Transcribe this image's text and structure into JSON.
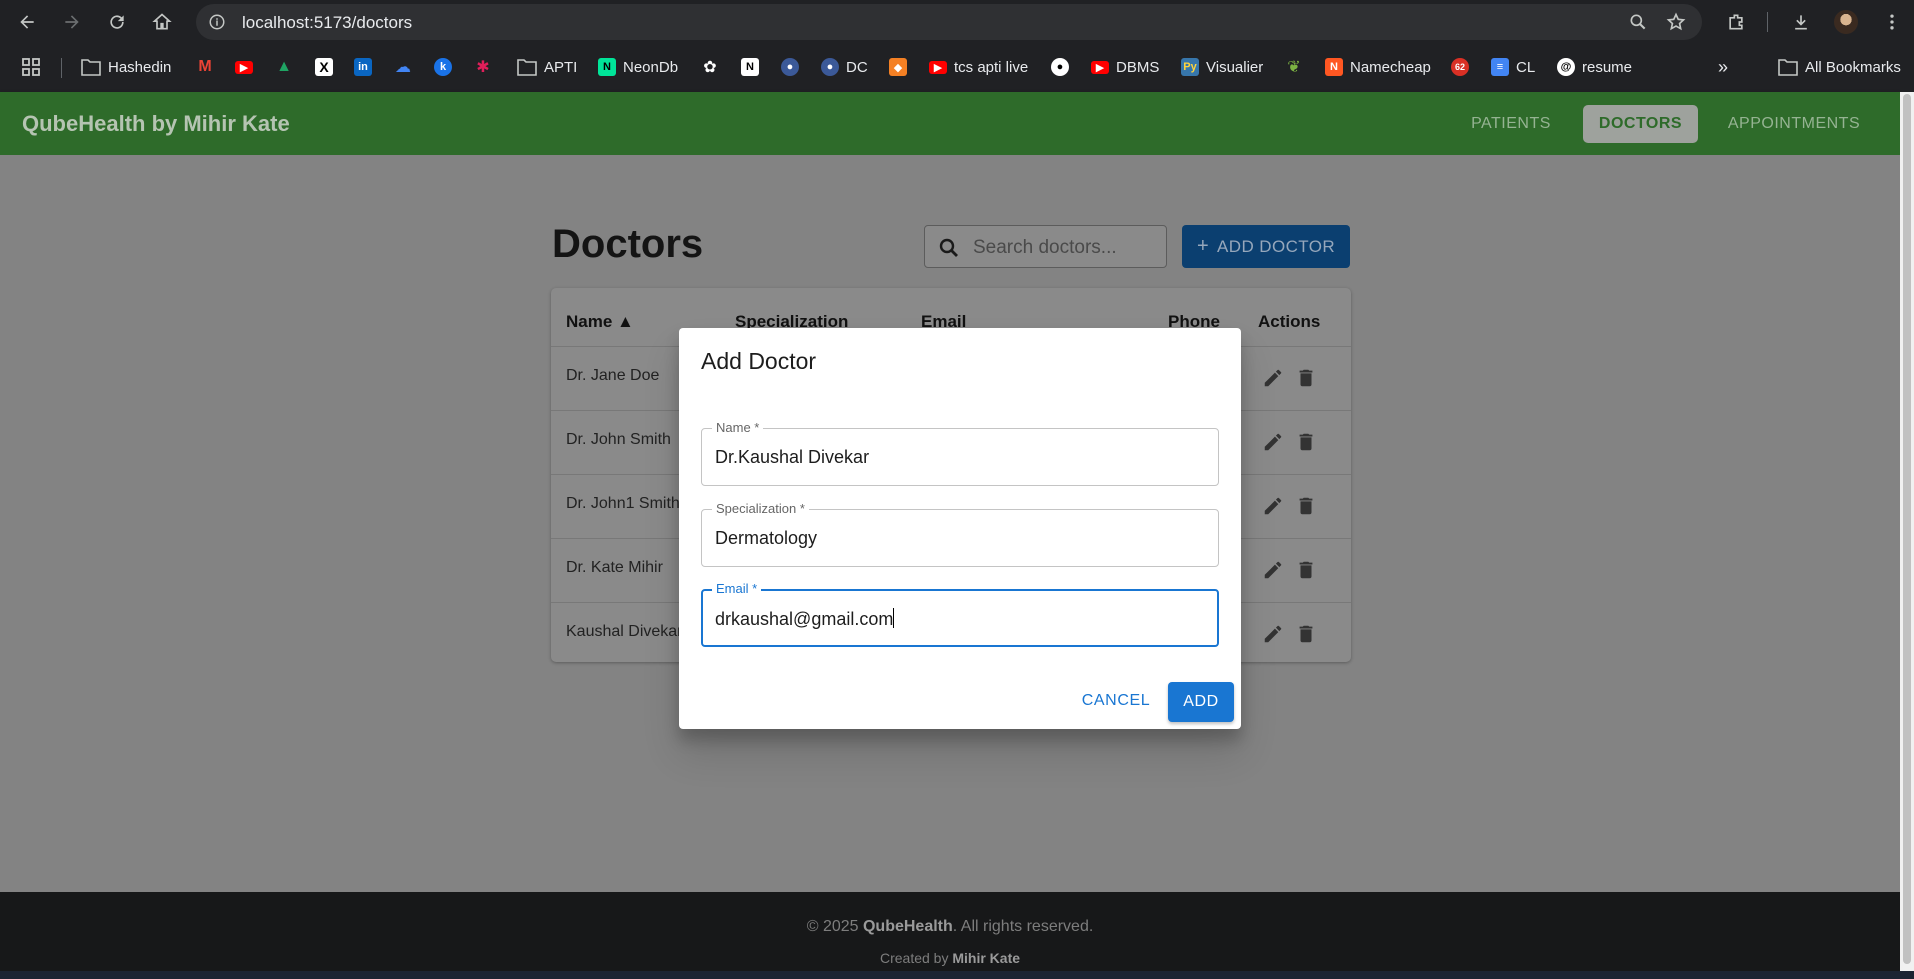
{
  "browser": {
    "url": "localhost:5173/doctors",
    "bookmarks": [
      {
        "label": "Hashedin",
        "icon": "folder-icon"
      },
      {
        "label": "",
        "icon": "gmail-icon",
        "color": "#ea4335"
      },
      {
        "label": "",
        "icon": "youtube-icon",
        "color": "#ff0000"
      },
      {
        "label": "",
        "icon": "drive-icon",
        "color": "#1fa463"
      },
      {
        "label": "",
        "icon": "x-icon",
        "color": "#000000"
      },
      {
        "label": "",
        "icon": "linkedin-icon",
        "color": "#0a66c2"
      },
      {
        "label": "",
        "icon": "cloud-icon",
        "color": "#4285f4"
      },
      {
        "label": "",
        "icon": "kotak-icon",
        "color": "#1a73e8"
      },
      {
        "label": "",
        "icon": "slack-icon",
        "color": "#e01e5a"
      },
      {
        "label": "APTI",
        "icon": "folder-icon"
      },
      {
        "label": "NeonDb",
        "icon": "neon-icon",
        "color": "#00e599"
      },
      {
        "label": "",
        "icon": "openai-icon",
        "color": "#ffffff"
      },
      {
        "label": "",
        "icon": "notion-icon",
        "color": "#ffffff"
      },
      {
        "label": "",
        "icon": "avatar-bookmark-icon",
        "color": "#3b5998"
      },
      {
        "label": "DC",
        "icon": "avatar-bookmark-icon",
        "color": "#3b5998"
      },
      {
        "label": "",
        "icon": "box-icon",
        "color": "#f48024"
      },
      {
        "label": "tcs apti live",
        "icon": "youtube-icon",
        "color": "#ff0000"
      },
      {
        "label": "",
        "icon": "github-icon",
        "color": "#ffffff"
      },
      {
        "label": "DBMS",
        "icon": "youtube-icon",
        "color": "#ff0000"
      },
      {
        "label": "Visualier",
        "icon": "python-icon",
        "color": "#3776ab"
      },
      {
        "label": "",
        "icon": "leaf-icon",
        "color": "#7cb342"
      },
      {
        "label": "Namecheap",
        "icon": "namecheap-icon",
        "color": "#ff5722"
      },
      {
        "label": "",
        "icon": "badge-62-icon",
        "color": "#d93025"
      },
      {
        "label": "CL",
        "icon": "docs-icon",
        "color": "#4285f4"
      },
      {
        "label": "resume",
        "icon": "swirl-icon",
        "color": "#ffffff"
      }
    ],
    "badge_count": "62",
    "all_bookmarks": "All Bookmarks"
  },
  "app": {
    "brand": "QubeHealth by Mihir Kate",
    "nav": [
      "PATIENTS",
      "DOCTORS",
      "APPOINTMENTS"
    ],
    "active_nav": "DOCTORS",
    "colors": {
      "header": "#2e6b2a",
      "primary": "#1976d2"
    }
  },
  "doctors_page": {
    "title": "Doctors",
    "search_placeholder": "Search doctors...",
    "add_button": "ADD DOCTOR",
    "columns": [
      "Name ▲",
      "Specialization",
      "Email",
      "Phone",
      "Actions"
    ],
    "rows": [
      {
        "name": "Dr. Jane Doe"
      },
      {
        "name": "Dr. John Smith"
      },
      {
        "name": "Dr. John1 Smith"
      },
      {
        "name": "Dr. Kate Mihir"
      },
      {
        "name": "Kaushal Divekar"
      }
    ]
  },
  "dialog": {
    "title": "Add Doctor",
    "fields": [
      {
        "label": "Name *",
        "value": "Dr.Kaushal Divekar"
      },
      {
        "label": "Specialization *",
        "value": "Dermatology"
      },
      {
        "label": "Email *",
        "value": "drkaushal@gmail.com"
      }
    ],
    "cancel": "CANCEL",
    "add": "ADD"
  },
  "footer": {
    "copyright_prefix": "© 2025",
    "brand": "QubeHealth",
    "copyright_suffix": ". All rights reserved.",
    "created_prefix": "Created by",
    "author": "Mihir Kate"
  }
}
